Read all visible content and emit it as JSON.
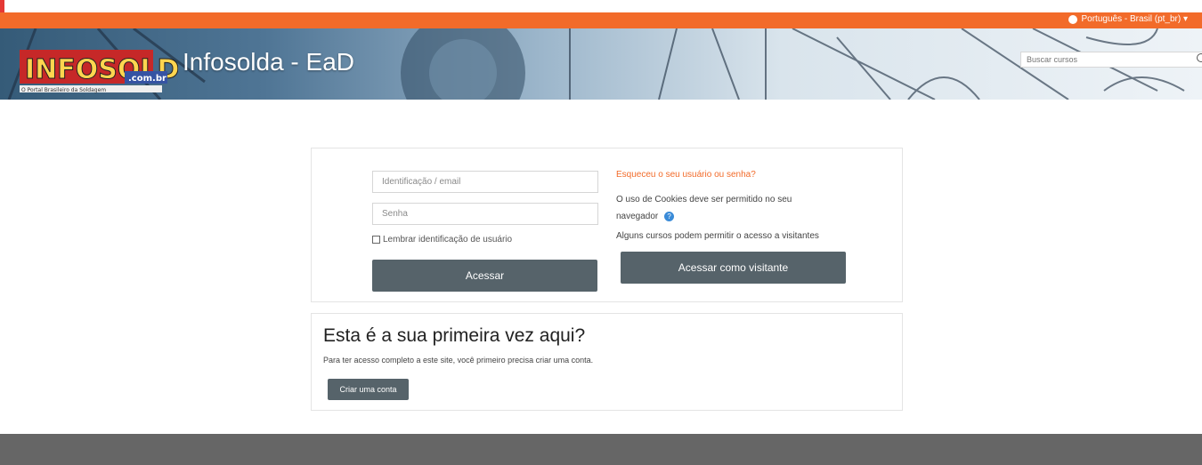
{
  "header": {
    "language": "Português - Brasil (pt_br) ▾",
    "logo_text": "INFOSOLDA",
    "logo_suffix": ".com.br",
    "logo_tagline": "O Portal Brasileiro da Soldagem",
    "site_name": "Infosolda - EaD",
    "search_placeholder": "Buscar cursos"
  },
  "login": {
    "username_placeholder": "Identificação / email",
    "password_placeholder": "Senha",
    "remember_label": "Lembrar identificação de usuário",
    "submit_label": "Acessar",
    "forgot_label": "Esqueceu o seu usuário ou senha?",
    "cookies_text": "O uso de Cookies deve ser permitido no seu navegador",
    "visitors_text": "Alguns cursos podem permitir o acesso a visitantes",
    "guest_label": "Acessar como visitante"
  },
  "signup": {
    "title": "Esta é a sua primeira vez aqui?",
    "text": "Para ter acesso completo a este site, você primeiro precisa criar uma conta.",
    "button_label": "Criar uma conta"
  },
  "colors": {
    "accent": "#f26b2a",
    "button": "#56636a",
    "footer": "#666666"
  }
}
